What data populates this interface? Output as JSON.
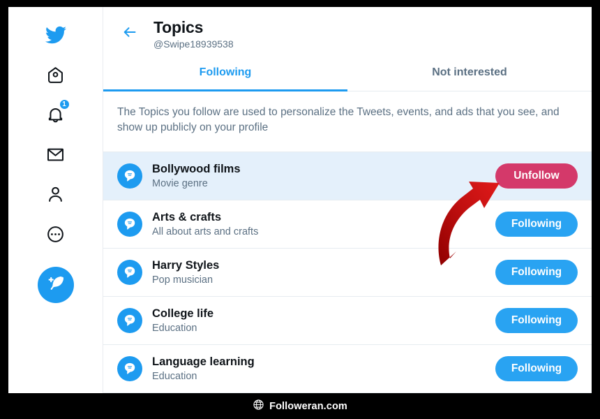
{
  "app": {
    "brand_color": "#1d9bf0",
    "unfollow_color": "#d4396a",
    "following_color": "#29a3f2",
    "highlight_row_color": "#e4f0fb"
  },
  "sidebar": {
    "items": [
      {
        "name": "twitter-logo",
        "icon": "twitter-bird-icon",
        "badge": null
      },
      {
        "name": "home",
        "icon": "home-icon",
        "badge": null
      },
      {
        "name": "notifications",
        "icon": "bell-icon",
        "badge": "1"
      },
      {
        "name": "messages",
        "icon": "envelope-icon",
        "badge": null
      },
      {
        "name": "profile",
        "icon": "person-icon",
        "badge": null
      },
      {
        "name": "more",
        "icon": "more-dots-icon",
        "badge": null
      }
    ],
    "compose": {
      "icon": "feather-plus-icon"
    }
  },
  "header": {
    "back_icon": "arrow-left-icon",
    "title": "Topics",
    "handle": "@Swipe18939538"
  },
  "tabs": [
    {
      "label": "Following",
      "active": true
    },
    {
      "label": "Not interested",
      "active": false
    }
  ],
  "description": "The Topics you follow are used to personalize the Tweets, events, and ads that you see, and show up publicly on your profile",
  "topics": [
    {
      "name": "Bollywood films",
      "description": "Movie genre",
      "action": "Unfollow",
      "action_state": "unfollow",
      "highlighted": true
    },
    {
      "name": "Arts & crafts",
      "description": "All about arts and crafts",
      "action": "Following",
      "action_state": "following",
      "highlighted": false
    },
    {
      "name": "Harry Styles",
      "description": "Pop musician",
      "action": "Following",
      "action_state": "following",
      "highlighted": false
    },
    {
      "name": "College life",
      "description": "Education",
      "action": "Following",
      "action_state": "following",
      "highlighted": false
    },
    {
      "name": "Language learning",
      "description": "Education",
      "action": "Following",
      "action_state": "following",
      "highlighted": false
    }
  ],
  "annotation": {
    "arrow_color": "#c00000",
    "points_to": "Unfollow"
  },
  "watermark": {
    "icon": "globe-icon",
    "text": "Followeran.com"
  }
}
